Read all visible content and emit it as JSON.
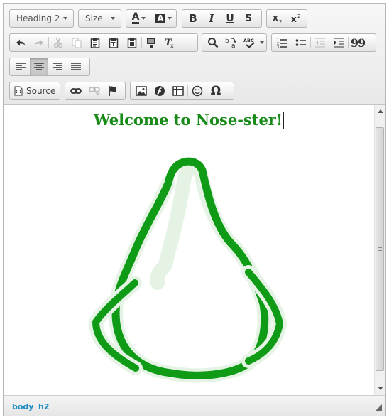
{
  "toolbar": {
    "format_label": "Heading 2",
    "size_label": "Size",
    "source_label": "Source",
    "font_color_glyph": "A",
    "bg_color_glyph": "A",
    "bold_glyph": "B",
    "italic_glyph": "I",
    "underline_glyph": "U",
    "strike_glyph": "S",
    "quote_glyph": "99",
    "omega_glyph": "Ω"
  },
  "content": {
    "heading": "Welcome to Nose-ster!",
    "drawing_color": "#0f9b16"
  },
  "status": {
    "crumbs": [
      "body",
      "h2"
    ]
  },
  "colors": {
    "heading": "#178a17",
    "link": "#1a8bbf"
  }
}
